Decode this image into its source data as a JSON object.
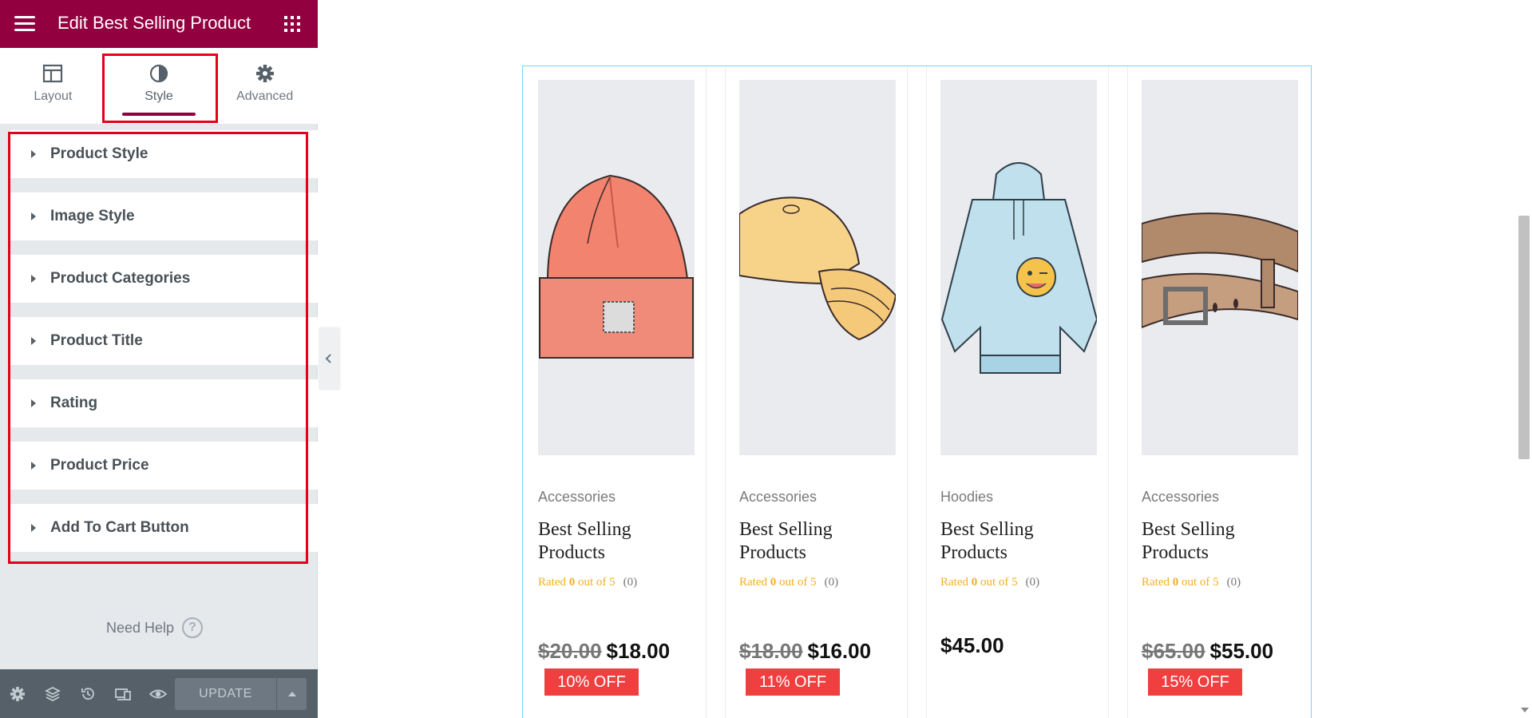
{
  "panel": {
    "title": "Edit Best Selling Product",
    "tabs": [
      {
        "label": "Layout",
        "icon": "layout-icon"
      },
      {
        "label": "Style",
        "icon": "half-circle-icon",
        "active": true
      },
      {
        "label": "Advanced",
        "icon": "gear-icon"
      }
    ],
    "sections": [
      {
        "label": "Product Style"
      },
      {
        "label": "Image Style"
      },
      {
        "label": "Product Categories"
      },
      {
        "label": "Product Title"
      },
      {
        "label": "Rating"
      },
      {
        "label": "Product Price"
      },
      {
        "label": "Add To Cart Button"
      }
    ],
    "need_help": "Need Help",
    "help_icon_glyph": "?",
    "footer": {
      "icons": [
        "settings-icon",
        "layers-icon",
        "history-icon",
        "responsive-icon",
        "preview-eye-icon"
      ],
      "update_label": "UPDATE"
    }
  },
  "colors": {
    "header_bg": "#93003f",
    "highlight": "#e3001b",
    "sale_badge": "#ef3f3f",
    "rating": "#f2b01e",
    "grid_border": "#71d7f7"
  },
  "products": [
    {
      "image": "beanie-hat",
      "category": "Accessories",
      "title": "Best Selling Products",
      "rating_prefix": "Rated",
      "rating_value": "0",
      "rating_suffix": "out of 5",
      "rating_count": "(0)",
      "old_price": "$20.00",
      "price": "$18.00",
      "badge": "10% OFF"
    },
    {
      "image": "baseball-cap",
      "category": "Accessories",
      "title": "Best Selling Products",
      "rating_prefix": "Rated",
      "rating_value": "0",
      "rating_suffix": "out of 5",
      "rating_count": "(0)",
      "old_price": "$18.00",
      "price": "$16.00",
      "badge": "11% OFF"
    },
    {
      "image": "hoodie",
      "category": "Hoodies",
      "title": "Best Selling Products",
      "rating_prefix": "Rated",
      "rating_value": "0",
      "rating_suffix": "out of 5",
      "rating_count": "(0)",
      "old_price": "",
      "price": "$45.00",
      "badge": ""
    },
    {
      "image": "belt",
      "category": "Accessories",
      "title": "Best Selling Products",
      "rating_prefix": "Rated",
      "rating_value": "0",
      "rating_suffix": "out of 5",
      "rating_count": "(0)",
      "old_price": "$65.00",
      "price": "$55.00",
      "badge": "15% OFF"
    }
  ]
}
